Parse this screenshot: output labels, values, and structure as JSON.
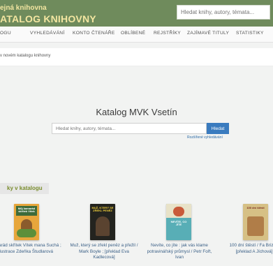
{
  "header": {
    "brand_line1": "ejná knihovna",
    "brand_line2": "ATALOG KNIHOVNY",
    "search_placeholder": "Hledat knihy, autory, témata..."
  },
  "nav": {
    "items": [
      "OGU",
      "VYHLEDÁVÁNÍ",
      "KONTO ČTENÁŘE",
      "OBLÍBENÉ",
      "REJSTŘÍKY",
      "ZAJÍMAVÉ TITULY",
      "STATISTIKY"
    ]
  },
  "breadcrumb": "v novém katalogu knihovny",
  "main": {
    "title": "Katalog MVK Vsetín",
    "search_placeholder": "Hledat knihy, autory, témata...",
    "search_button": "Hledat",
    "advanced_link": "Rozšířené vyhledávání"
  },
  "section": {
    "heading": "ky v katalogu"
  },
  "books": [
    {
      "caption": "kamarád skřítek Vítek mana Suchá ; ilustrace Zdeňka Študlarová",
      "cover_text": "Můj kamarád skřítek Vítek",
      "cover_color": "#e2a23a"
    },
    {
      "caption": "Muž, který se zřekl peněz a přežil / Mark Boyle ; [překlad Eva Kadlecová]",
      "cover_text": "MUŽ, KTERÝ SE ZŘEKL PENĚZ",
      "cover_color": "#2a2a28"
    },
    {
      "caption": "Nevíte, co jíte : jak vás klame potravinářský průmysl / Petr Fořt, Ivan",
      "cover_text": "NEVÍTE, CO JÍTE",
      "cover_color": "#5ab0b8"
    },
    {
      "caption": "100 dní štěstí / Fa Brizzi ; [překlad A Jíchová]",
      "cover_text": "100 dní štěstí",
      "cover_color": "#d9c48a"
    }
  ]
}
